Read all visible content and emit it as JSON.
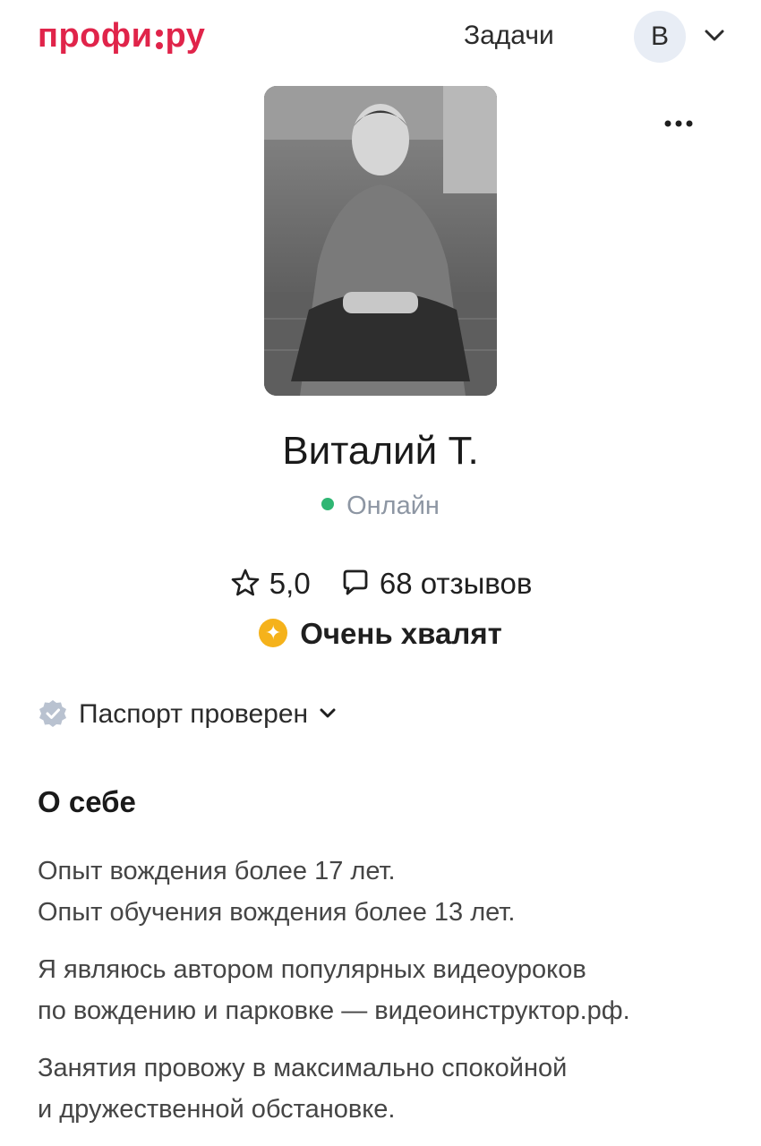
{
  "header": {
    "logo_left": "профи",
    "logo_right": "ру",
    "nav_tasks": "Задачи",
    "avatar_letter": "В"
  },
  "profile": {
    "name": "Виталий Т.",
    "status": "Онлайн",
    "rating": "5,0",
    "reviews": "68 отзывов",
    "praise": "Очень хвалят",
    "passport": "Паспорт проверен"
  },
  "about": {
    "title": "О себе",
    "paragraphs": [
      [
        "Опыт вождения более 17 лет.",
        "Опыт обучения вождения более 13 лет."
      ],
      [
        "Я являюсь автором популярных видеоуроков",
        "по вождению и парковке — видеоинструктор.рф."
      ],
      [
        "Занятия провожу в максимально спокойной",
        "и дружественной обстановке."
      ]
    ]
  },
  "colors": {
    "brand": "#e0244a",
    "online": "#2fb673",
    "praise_badge": "#f5b21b",
    "muted": "#8d96a3"
  },
  "icons": {
    "menu": "more-icon",
    "dropdown": "chevron-down-icon",
    "rating": "star-icon",
    "reviews": "comment-icon",
    "praise": "sparkle-icon",
    "passport": "verified-badge-icon"
  }
}
